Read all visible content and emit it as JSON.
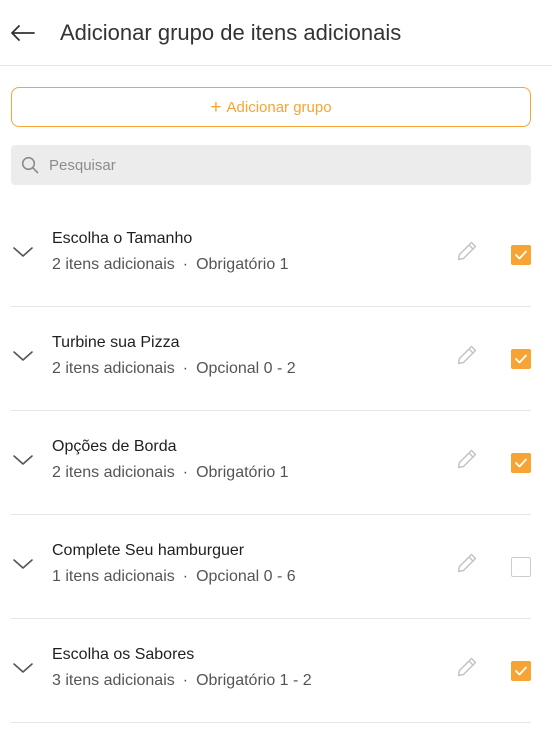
{
  "header": {
    "title": "Adicionar grupo de itens adicionais",
    "back_icon": "arrow-left-icon"
  },
  "add_group": {
    "plus": "+",
    "label": "Adicionar grupo"
  },
  "search": {
    "placeholder": "Pesquisar",
    "value": ""
  },
  "colors": {
    "accent": "#f7a435",
    "divider": "#e6e6e6",
    "search_bg": "#ececec"
  },
  "groups": [
    {
      "name": "Escolha o Tamanho",
      "items": "2 itens adicionais",
      "separator": "·",
      "rule": "Obrigatório 1",
      "checked": true
    },
    {
      "name": "Turbine sua Pizza",
      "items": "2 itens adicionais",
      "separator": "·",
      "rule": "Opcional 0 - 2",
      "checked": true
    },
    {
      "name": "Opções de Borda",
      "items": "2 itens adicionais",
      "separator": "·",
      "rule": "Obrigatório 1",
      "checked": true
    },
    {
      "name": "Complete Seu hamburguer",
      "items": "1 itens adicionais",
      "separator": "·",
      "rule": "Opcional 0 - 6",
      "checked": false
    },
    {
      "name": "Escolha os Sabores",
      "items": "3 itens adicionais",
      "separator": "·",
      "rule": "Obrigatório 1 - 2",
      "checked": true
    }
  ]
}
